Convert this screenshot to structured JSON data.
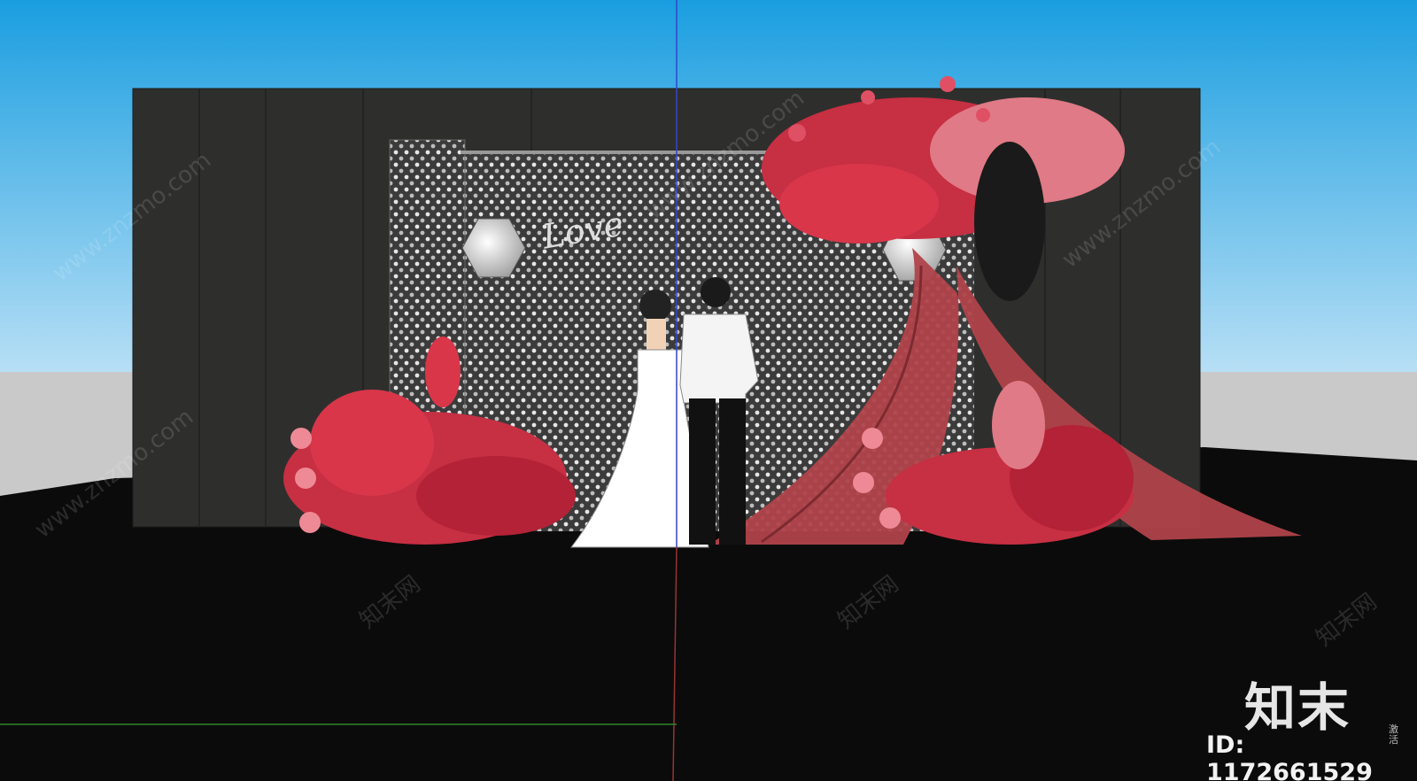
{
  "watermark": {
    "site": "www.znzmo.com",
    "brand_cn": "知末网",
    "logo": "知末",
    "id_label": "ID: 1172661529",
    "side_note": "激活"
  },
  "scene": {
    "sign_text": "Love",
    "colors": {
      "sky_top": "#1a9ee0",
      "sky_bottom": "#b7dff5",
      "ground": "#0b0b0b",
      "backdrop": "#2e2f2d",
      "curtain": "#8f8f8f",
      "drape": "#b0434a",
      "flowers": "#d9364a"
    }
  }
}
